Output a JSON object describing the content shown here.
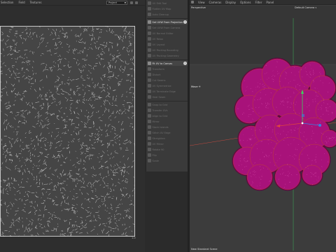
{
  "uv_editor": {
    "menu": [
      "Selection",
      "Field",
      "Textures"
    ],
    "project_select": "Project",
    "corner_label": "1.0"
  },
  "tools": {
    "items": [
      {
        "label": "UV Edit Tool",
        "active": false
      },
      {
        "label": "Flatten UV Map",
        "active": false
      },
      {
        "label": "Auto Cleanup",
        "active": false
      },
      {
        "label": "Set UVW From Projection",
        "active": true,
        "info": true
      },
      {
        "label": "Set UVW From Camera",
        "active": false
      },
      {
        "label": "UV Normal Editor",
        "active": false
      },
      {
        "label": "UV Relax",
        "active": false
      },
      {
        "label": "UV Layout",
        "active": false
      },
      {
        "label": "UV Packing Bounding",
        "active": false
      },
      {
        "label": "UV Packing Geometry",
        "active": false
      },
      {
        "label": "Fit UV to Canvas",
        "active": true,
        "info": true
      },
      {
        "label": "Transform",
        "active": false
      },
      {
        "label": "Distort",
        "active": false
      },
      {
        "label": "Cut Seams",
        "active": false
      },
      {
        "label": "UV Symmetrize",
        "active": false
      },
      {
        "label": "UV Terminate Edge",
        "active": false
      },
      {
        "label": "Heal Seam",
        "active": false
      },
      {
        "label": "Snap to Grid",
        "active": false
      },
      {
        "label": "Transfer UVs",
        "active": false
      },
      {
        "label": "Align to Grid",
        "active": false
      },
      {
        "label": "Mirror",
        "active": false
      },
      {
        "label": "Stack Islands",
        "active": false
      },
      {
        "label": "Stitch UV Edge",
        "active": false
      },
      {
        "label": "Straighten",
        "active": false
      },
      {
        "label": "UV Mirror",
        "active": false
      },
      {
        "label": "Rotate 90",
        "active": false
      },
      {
        "label": "Flip",
        "active": false
      },
      {
        "label": "Scale",
        "active": false
      }
    ]
  },
  "viewport": {
    "menu": [
      "View",
      "Cameras",
      "Display",
      "Options",
      "Filter",
      "Panel"
    ],
    "perspective_label": "Perspective",
    "camera_label": "Default Camera",
    "camera_chevron": "▾",
    "move_label": "Move ✛",
    "scene_label": "New Standard Scene"
  },
  "colors": {
    "mesh": "#a8127a",
    "mesh_dark": "#5e0444",
    "axis_x": "#e0463b",
    "axis_y": "#3ed160",
    "axis_z": "#3b7ee0"
  },
  "icons": {
    "dropdown": "chevron-down-icon",
    "info": "info-icon",
    "move_handle": "move-gizmo-icon"
  }
}
